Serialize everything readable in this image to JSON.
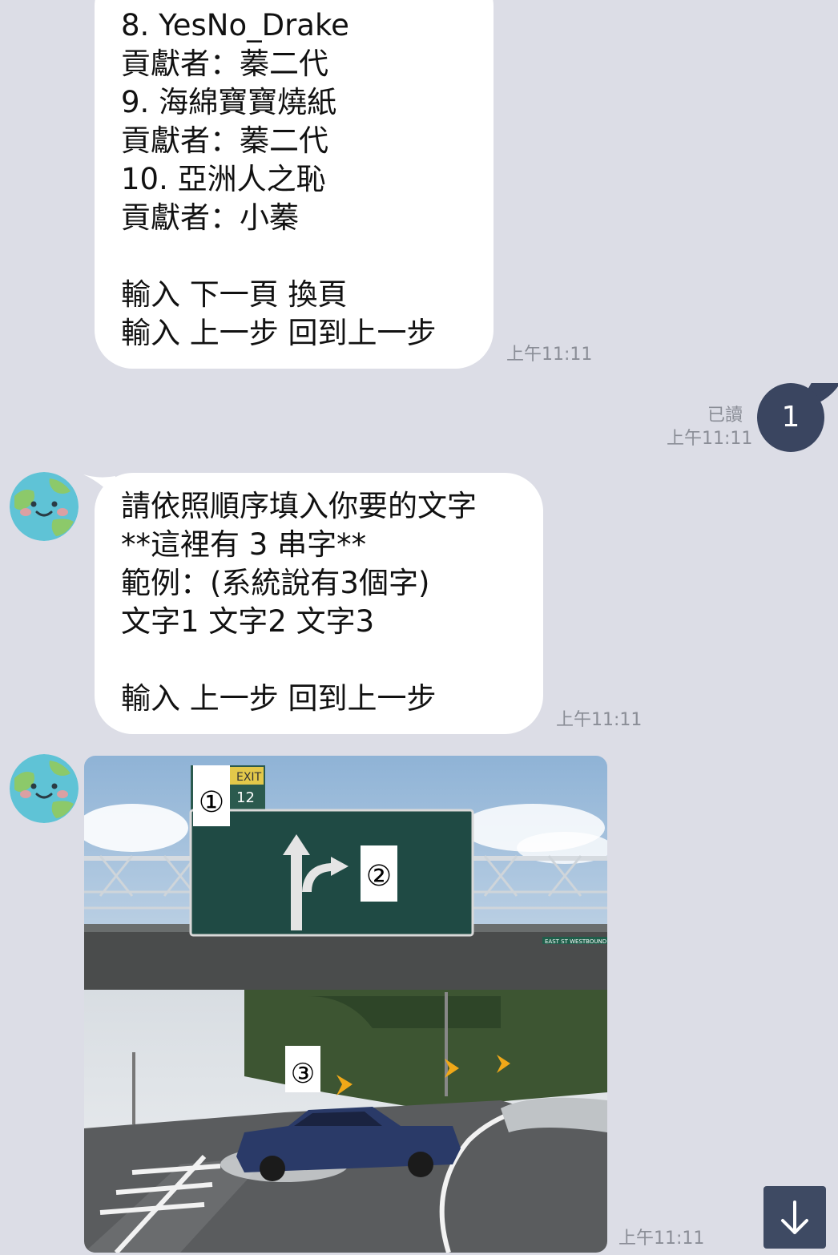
{
  "messages": {
    "list_bubble": {
      "lines": [
        "8. YesNo_Drake",
        "貢獻者：蓁二代",
        "9. 海綿寶寶燒紙",
        "貢獻者：蓁二代",
        "10. 亞洲人之恥",
        "貢獻者：小蓁",
        "",
        "輸入 下一頁 換頁",
        "輸入 上一步 回到上一步"
      ],
      "time": "上午11:11"
    },
    "user_message": {
      "read_label": "已讀",
      "time": "上午11:11",
      "text": "1"
    },
    "instruction_bubble": {
      "lines": [
        "請依照順序填入你要的文字",
        "**這裡有 3 串字**",
        "範例：(系統說有3個字)",
        "文字1 文字2 文字3",
        "",
        "輸入 上一步 回到上一步"
      ],
      "time": "上午11:11"
    },
    "image_message": {
      "markers": [
        "①",
        "②",
        "③"
      ],
      "sign_exit": "EXIT",
      "sign_number": "12",
      "street_sign": "EAST ST  WESTBOUND",
      "time": "上午11:11"
    }
  },
  "colors": {
    "background": "#dcdde6",
    "bubble": "#ffffff",
    "user_bubble": "#3a4560",
    "highway_sign": "#1f4a44"
  }
}
